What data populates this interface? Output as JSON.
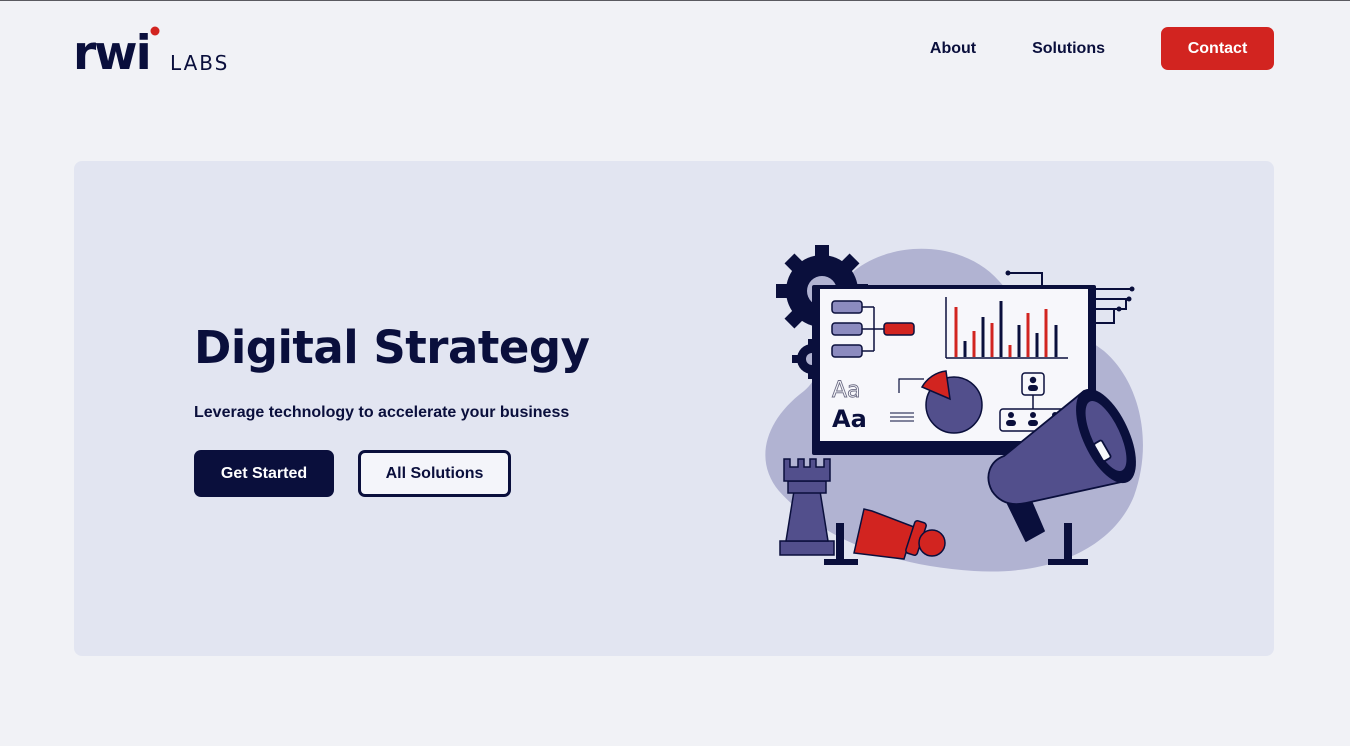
{
  "brand": {
    "logo_main": "rwi",
    "logo_sub": "LABS",
    "dark": "#0a0f3c",
    "accent": "#d22420",
    "hero_bg": "#e2e5f1",
    "page_bg": "#f1f2f6",
    "illustration_purple": "#524f8c"
  },
  "nav": {
    "about": "About",
    "solutions": "Solutions",
    "contact": "Contact"
  },
  "hero": {
    "title": "Digital Strategy",
    "subtitle": "Leverage technology to accelerate your business",
    "primary_button": "Get Started",
    "secondary_button": "All Solutions",
    "illustration": {
      "icons": [
        "gear-icon",
        "presentation-board-icon",
        "megaphone-icon",
        "chess-rook-icon",
        "chess-pawn-icon"
      ],
      "font_sample_outline": "Aa",
      "font_sample_solid": "Aa"
    }
  }
}
